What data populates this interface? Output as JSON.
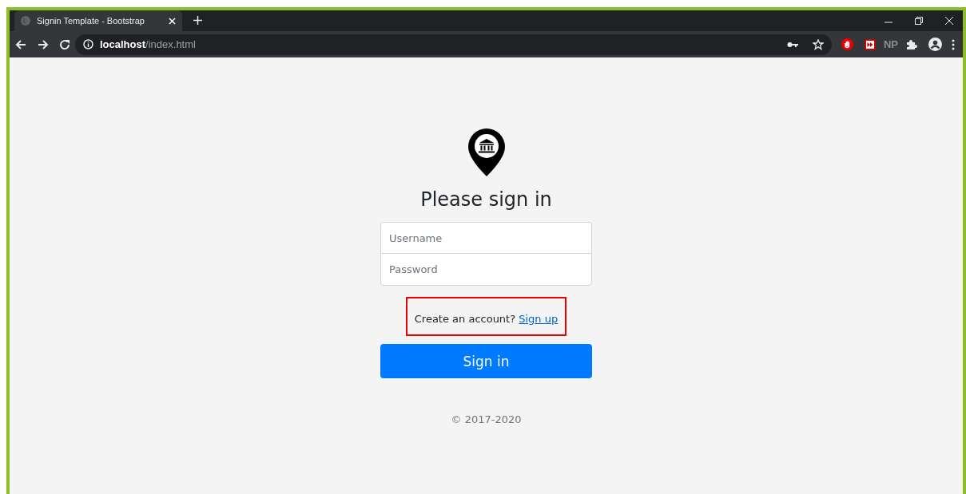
{
  "browser": {
    "tab": {
      "title": "Signin Template - Bootstrap",
      "selected": true
    },
    "address": {
      "host": "localhost",
      "path": "/index.html"
    },
    "extension_label": "NP"
  },
  "form": {
    "heading": "Please sign in",
    "username": {
      "placeholder": "Username"
    },
    "password": {
      "placeholder": "Password"
    },
    "signup_prompt": "Create an account?",
    "signup_link": "Sign up",
    "submit": "Sign in",
    "footer": "© 2017-2020"
  }
}
